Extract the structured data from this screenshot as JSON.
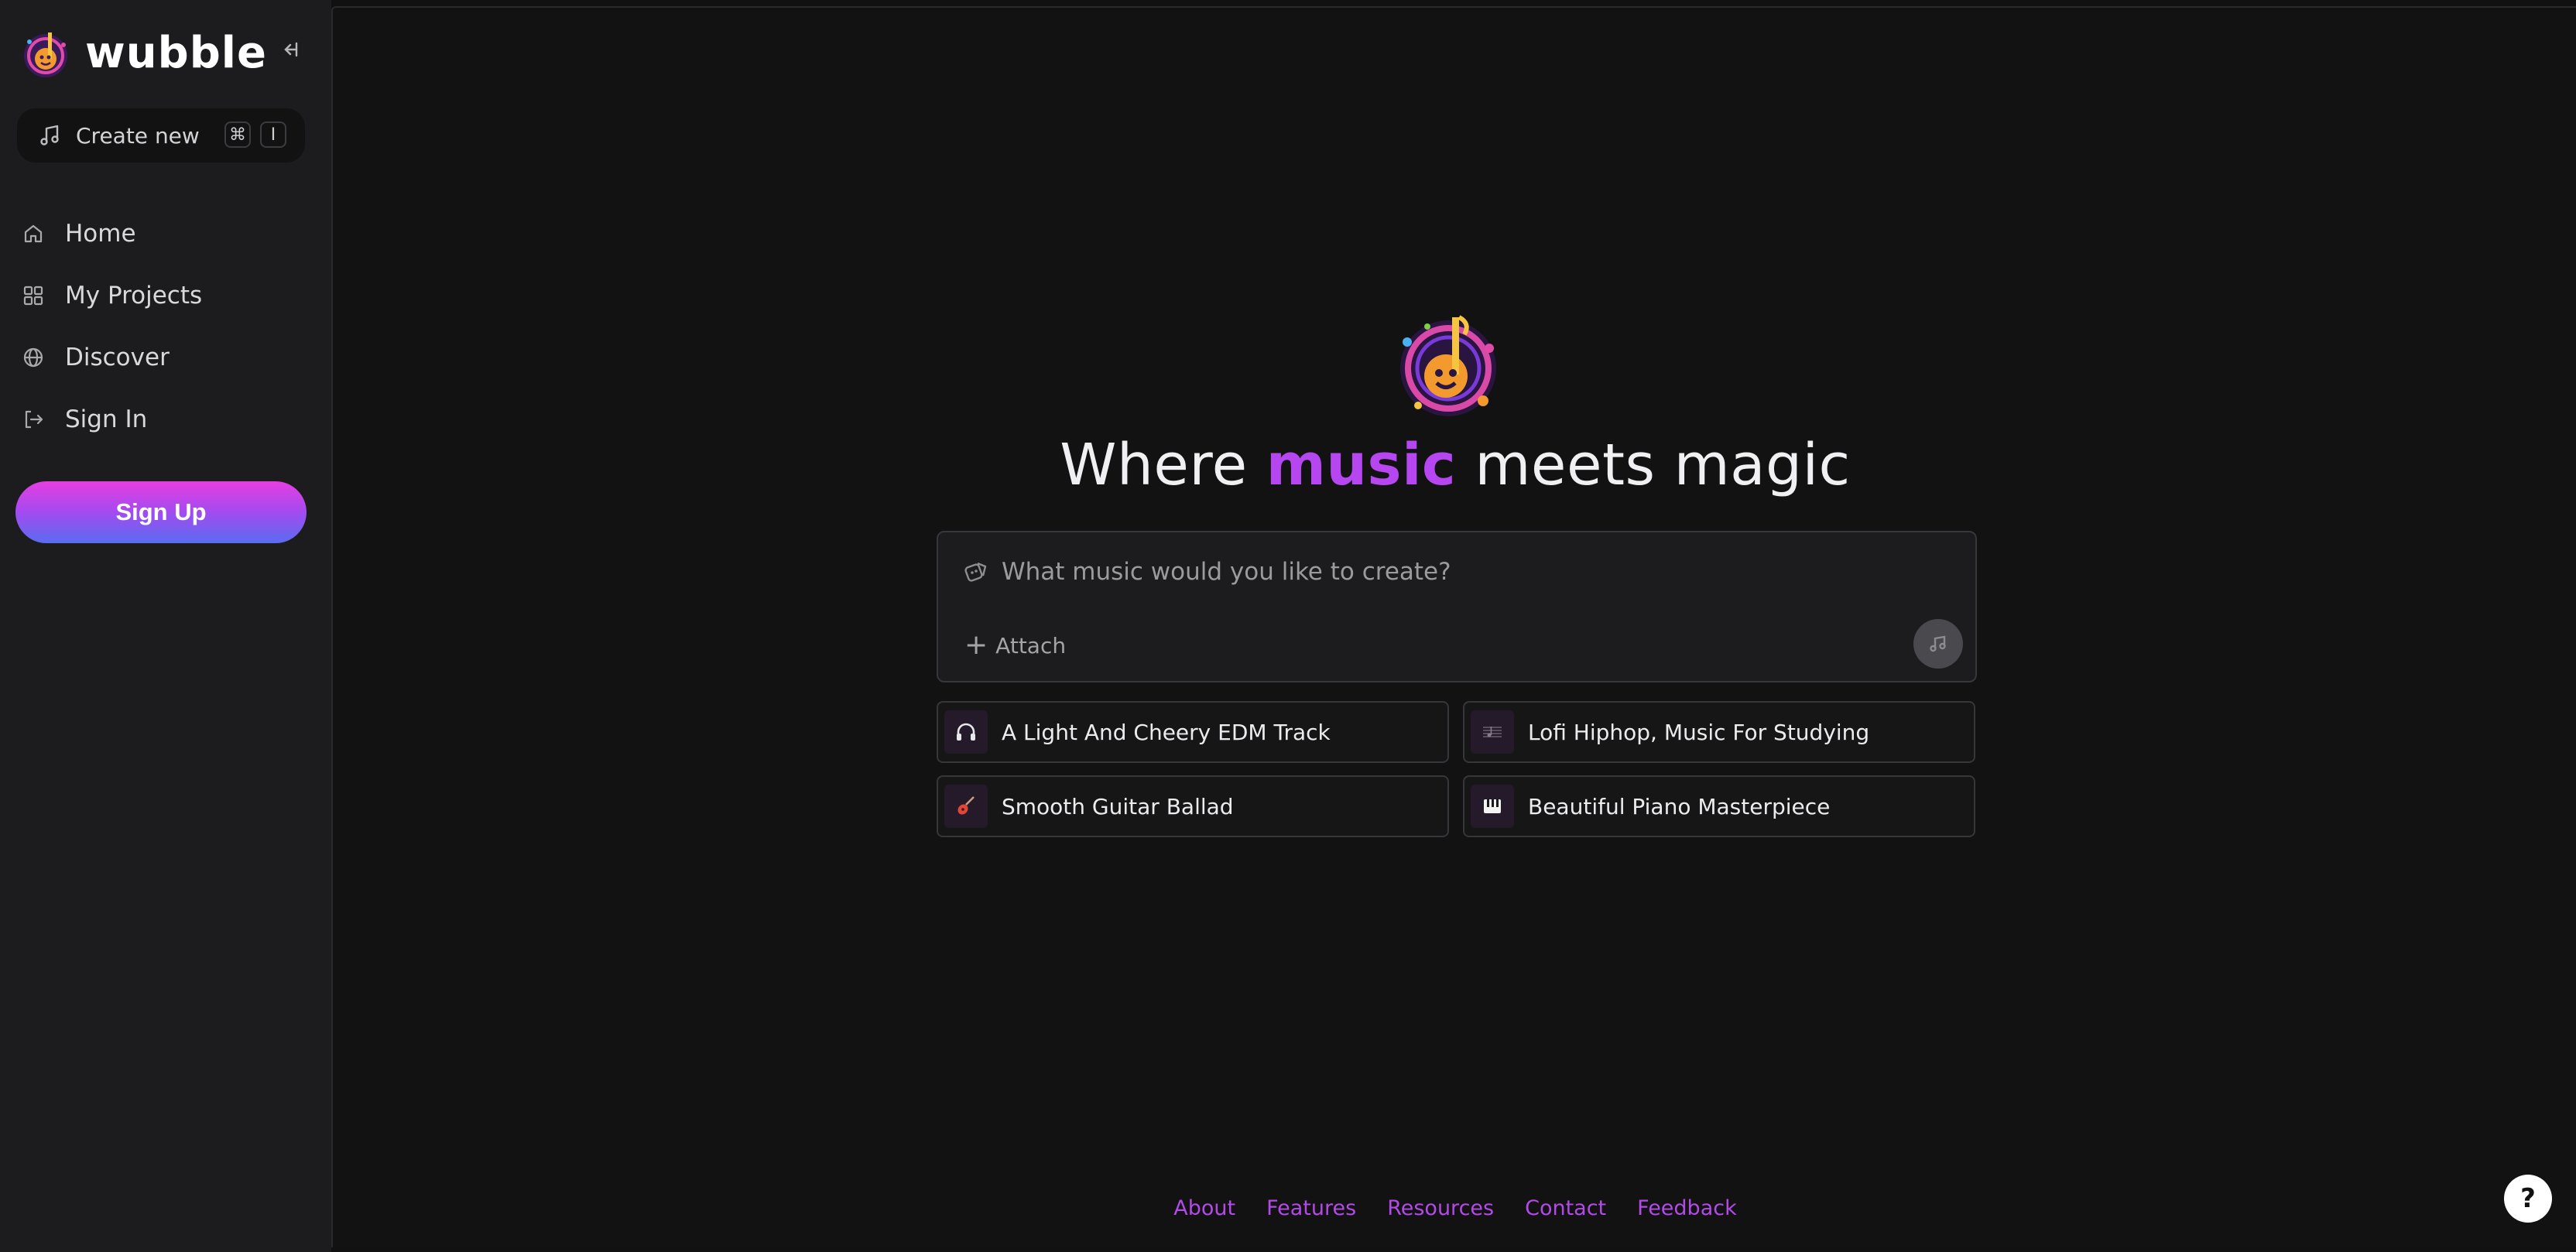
{
  "brand": {
    "name": "wubble"
  },
  "sidebar": {
    "collapse_icon": "collapse-sidebar-icon",
    "create_new": {
      "label": "Create new",
      "shortcut_keys": [
        "⌘",
        "I"
      ]
    },
    "items": [
      {
        "label": "Home",
        "icon": "home-icon"
      },
      {
        "label": "My Projects",
        "icon": "grid-icon"
      },
      {
        "label": "Discover",
        "icon": "globe-icon"
      },
      {
        "label": "Sign In",
        "icon": "sign-in-icon"
      }
    ],
    "signup_label": "Sign Up"
  },
  "hero": {
    "headline_before": "Where ",
    "headline_accent": "music",
    "headline_after": " meets magic"
  },
  "prompt": {
    "placeholder": "What music would you like to create?",
    "value": "",
    "attach_label": "Attach"
  },
  "suggestions": [
    {
      "label": "A Light And Cheery EDM Track",
      "icon": "headphones-icon"
    },
    {
      "label": "Lofi Hiphop, Music For Studying",
      "icon": "sheet-music-icon"
    },
    {
      "label": "Smooth Guitar Ballad",
      "icon": "guitar-icon"
    },
    {
      "label": "Beautiful Piano Masterpiece",
      "icon": "piano-keys-icon"
    }
  ],
  "footer": {
    "links": [
      "About",
      "Features",
      "Resources",
      "Contact",
      "Feedback"
    ]
  },
  "help_label": "?",
  "colors": {
    "accent": "#b646f0",
    "footer_link": "#b24ae8",
    "signup_gradient_start": "#e63ee0",
    "signup_gradient_end": "#5a6cf0",
    "background": "#121212",
    "sidebar": "#1c1c1e"
  }
}
